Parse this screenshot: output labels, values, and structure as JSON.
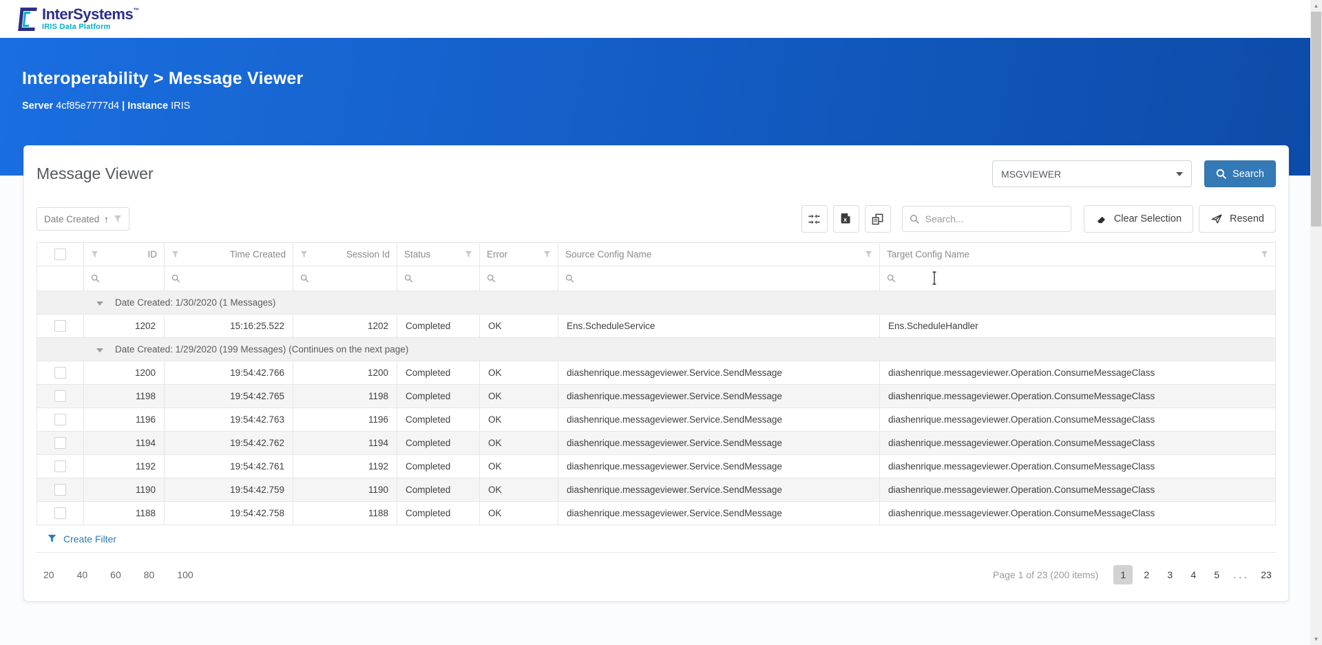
{
  "topbar": {
    "brand": "InterSystems",
    "trademark": "™",
    "platform": "IRIS Data Platform"
  },
  "hero": {
    "breadcrumb": "Interoperability > Message Viewer",
    "server_label": "Server",
    "server_value": "4cf85e7777d4",
    "divider": "|",
    "instance_label": "Instance",
    "instance_value": "IRIS"
  },
  "panel": {
    "title": "Message Viewer",
    "namespace_value": "MSGVIEWER",
    "search_label": "Search"
  },
  "toolbar": {
    "sort_label": "Date Created",
    "sort_direction": "↑",
    "search_placeholder": "Search...",
    "clear_label": "Clear Selection",
    "resend_label": "Resend"
  },
  "table": {
    "columns": [
      {
        "key": "id",
        "label": "ID",
        "align": "right"
      },
      {
        "key": "time",
        "label": "Time Created",
        "align": "right"
      },
      {
        "key": "session",
        "label": "Session Id",
        "align": "right"
      },
      {
        "key": "status",
        "label": "Status",
        "align": "left"
      },
      {
        "key": "error",
        "label": "Error",
        "align": "left"
      },
      {
        "key": "source",
        "label": "Source Config Name",
        "align": "left"
      },
      {
        "key": "target",
        "label": "Target Config Name",
        "align": "left"
      }
    ],
    "groups": [
      {
        "label": "Date Created: 1/30/2020 (1 Messages)",
        "rows": [
          {
            "id": "1202",
            "time": "15:16:25.522",
            "session": "1202",
            "status": "Completed",
            "error": "OK",
            "source": "Ens.ScheduleService",
            "target": "Ens.ScheduleHandler"
          }
        ]
      },
      {
        "label": "Date Created: 1/29/2020 (199 Messages) (Continues on the next page)",
        "rows": [
          {
            "id": "1200",
            "time": "19:54:42.766",
            "session": "1200",
            "status": "Completed",
            "error": "OK",
            "source": "diashenrique.messageviewer.Service.SendMessage",
            "target": "diashenrique.messageviewer.Operation.ConsumeMessageClass"
          },
          {
            "id": "1198",
            "time": "19:54:42.765",
            "session": "1198",
            "status": "Completed",
            "error": "OK",
            "source": "diashenrique.messageviewer.Service.SendMessage",
            "target": "diashenrique.messageviewer.Operation.ConsumeMessageClass"
          },
          {
            "id": "1196",
            "time": "19:54:42.763",
            "session": "1196",
            "status": "Completed",
            "error": "OK",
            "source": "diashenrique.messageviewer.Service.SendMessage",
            "target": "diashenrique.messageviewer.Operation.ConsumeMessageClass"
          },
          {
            "id": "1194",
            "time": "19:54:42.762",
            "session": "1194",
            "status": "Completed",
            "error": "OK",
            "source": "diashenrique.messageviewer.Service.SendMessage",
            "target": "diashenrique.messageviewer.Operation.ConsumeMessageClass"
          },
          {
            "id": "1192",
            "time": "19:54:42.761",
            "session": "1192",
            "status": "Completed",
            "error": "OK",
            "source": "diashenrique.messageviewer.Service.SendMessage",
            "target": "diashenrique.messageviewer.Operation.ConsumeMessageClass"
          },
          {
            "id": "1190",
            "time": "19:54:42.759",
            "session": "1190",
            "status": "Completed",
            "error": "OK",
            "source": "diashenrique.messageviewer.Service.SendMessage",
            "target": "diashenrique.messageviewer.Operation.ConsumeMessageClass"
          },
          {
            "id": "1188",
            "time": "19:54:42.758",
            "session": "1188",
            "status": "Completed",
            "error": "OK",
            "source": "diashenrique.messageviewer.Service.SendMessage",
            "target": "diashenrique.messageviewer.Operation.ConsumeMessageClass"
          }
        ]
      }
    ]
  },
  "footer": {
    "create_filter_label": "Create Filter",
    "page_sizes": [
      "20",
      "40",
      "60",
      "80",
      "100"
    ],
    "page_info": "Page 1 of 23 (200 items)",
    "pages": [
      "1",
      "2",
      "3",
      "4",
      "5",
      "...",
      "23"
    ],
    "active_page": "1"
  },
  "icons": {
    "logo_mark": "intersystems-bracket",
    "search": "magnifier",
    "column_filter": "funnel",
    "sort": "arrow-up",
    "collapse_all": "arrows-inward",
    "export_excel": "xlsx-file",
    "column_chooser": "overlapping-panels",
    "clear_selection": "eraser",
    "resend": "paper-plane",
    "group_toggle": "triangle-down",
    "select_caret": "triangle-down"
  },
  "colors": {
    "hero_gradient_start": "#1a6ee0",
    "hero_gradient_end": "#0d4ba8",
    "primary_button": "#337ab7",
    "link_blue": "#2b7bb9",
    "brand_navy": "#2c2f88",
    "brand_teal": "#00aec6",
    "active_page_bg": "#d2d2d2",
    "group_row_bg": "#f1f1f1",
    "alt_row_bg": "#f5f5f5"
  }
}
